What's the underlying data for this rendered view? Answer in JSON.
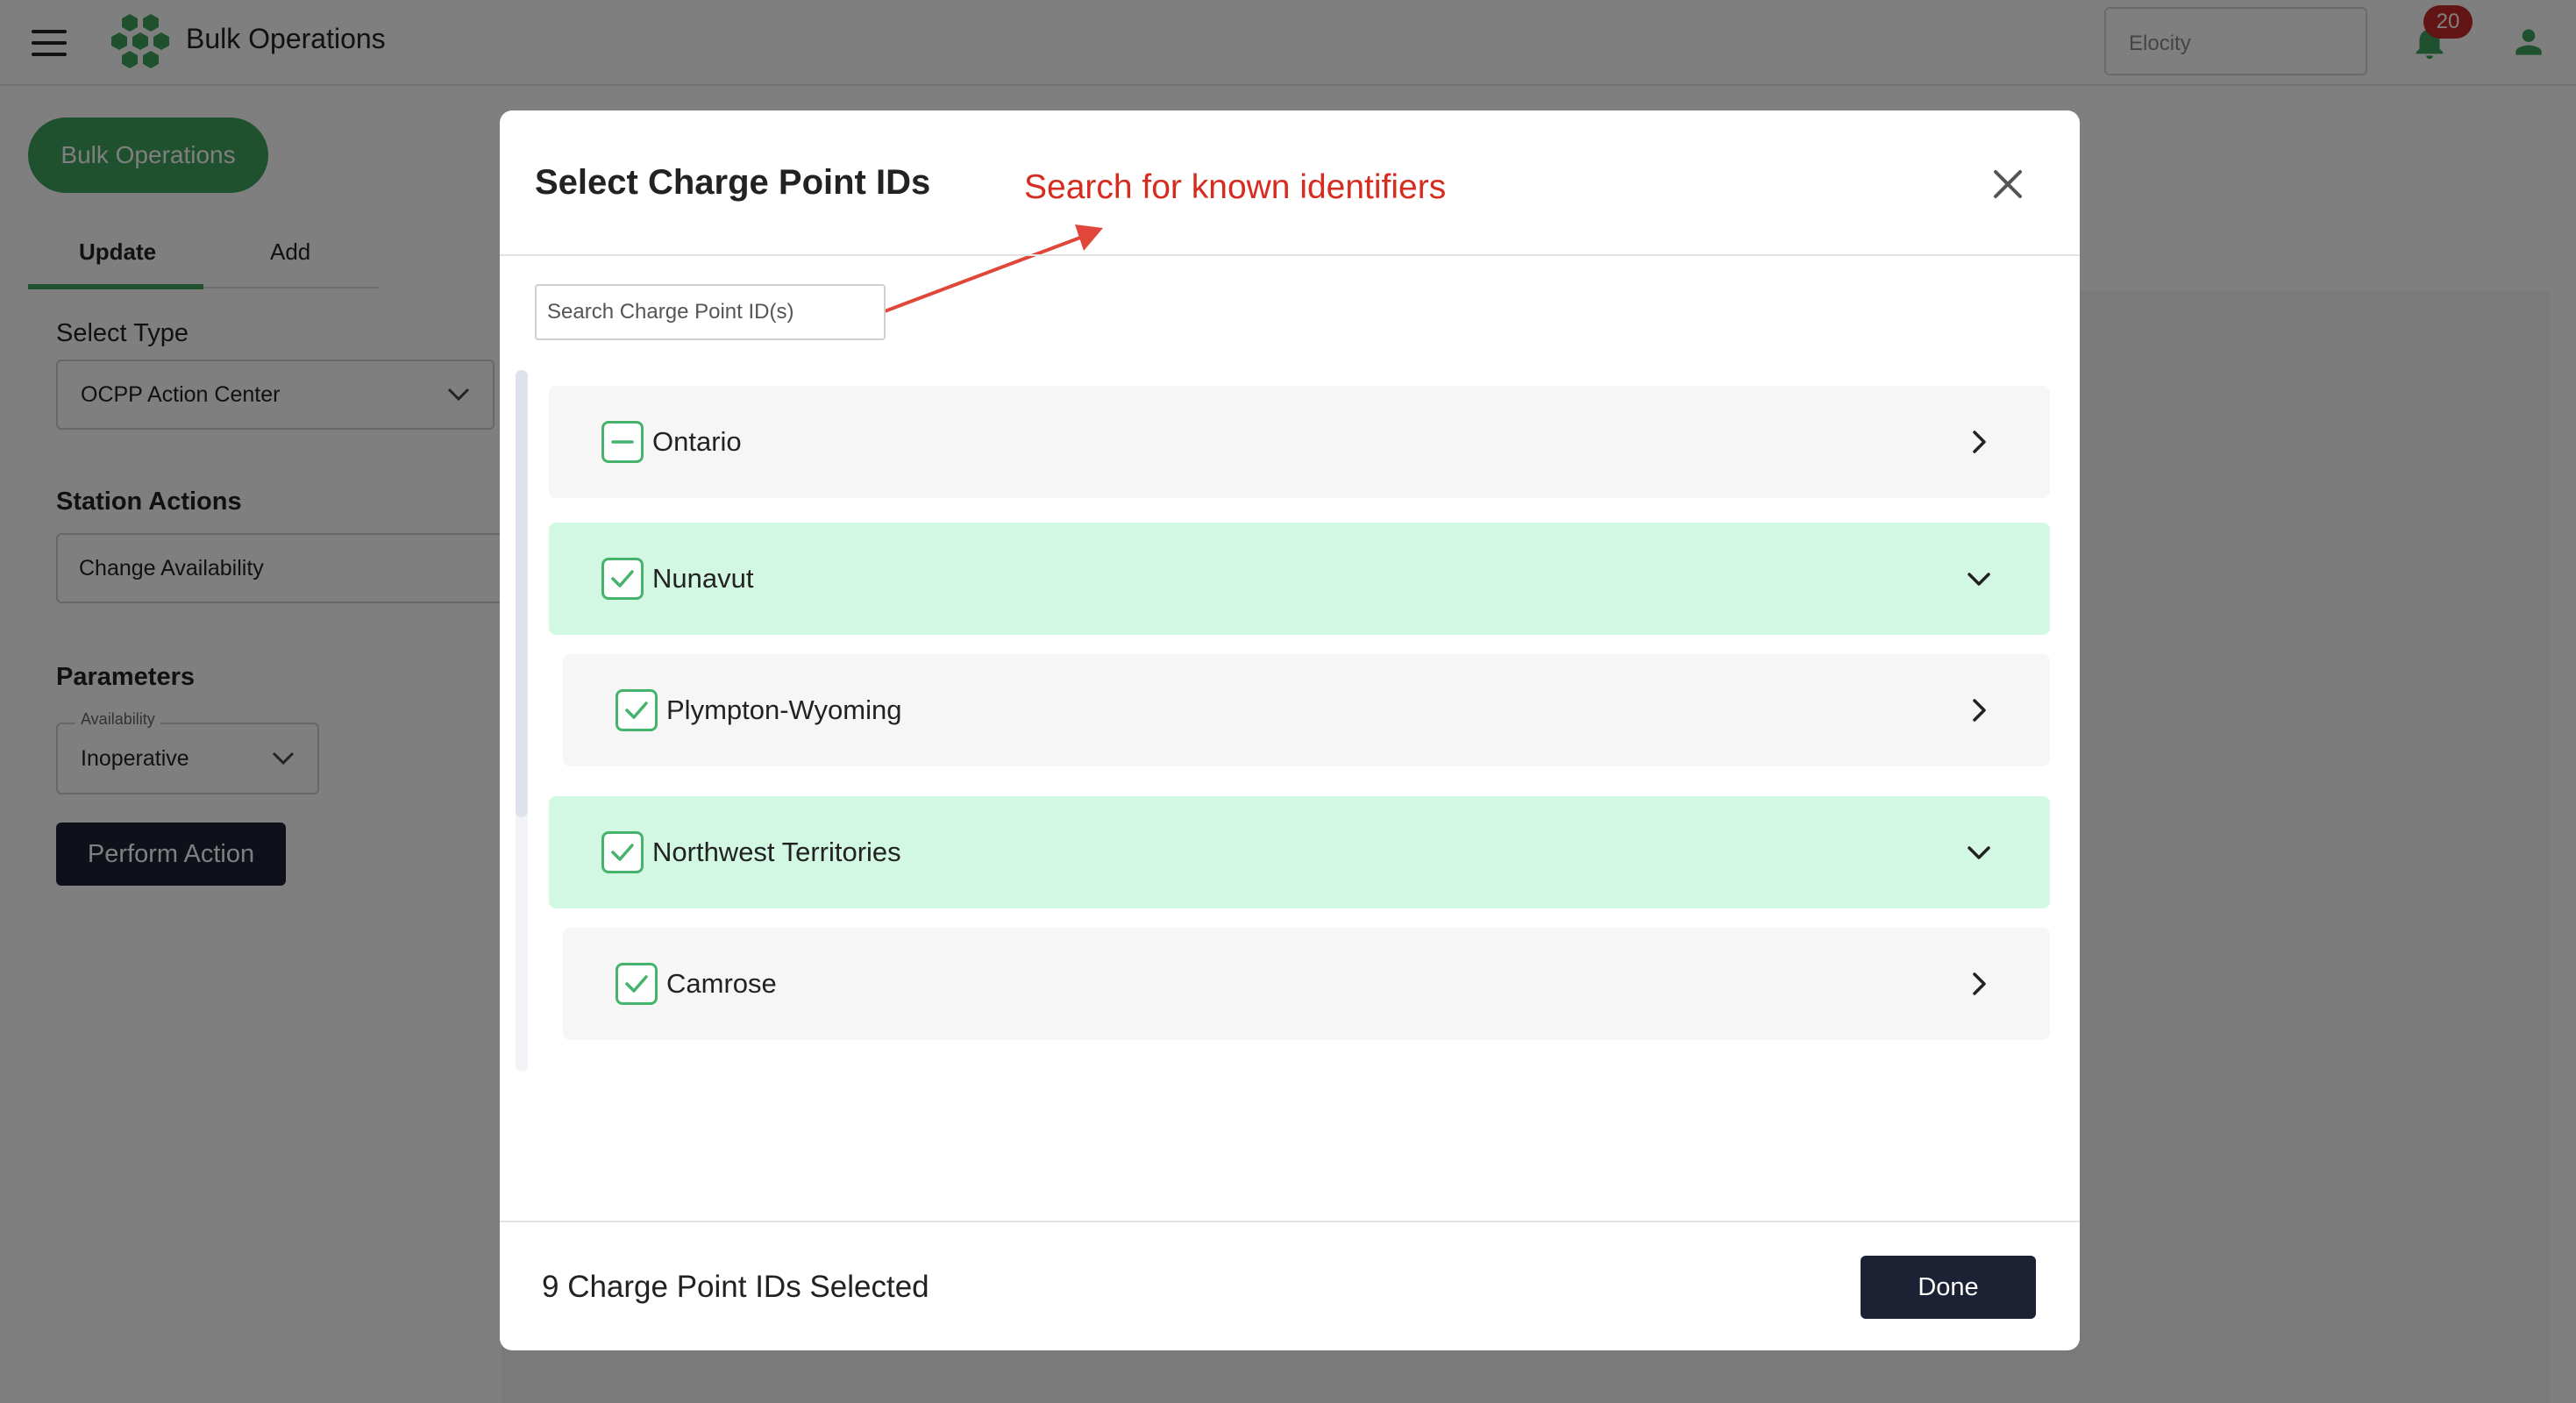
{
  "app": {
    "title": "Bulk Operations",
    "tenant_placeholder": "Elocity",
    "notification_count": "20",
    "brand_color": "#3ea35e"
  },
  "page": {
    "bulk_button": "Bulk Operations",
    "tabs": [
      "Update",
      "Add"
    ],
    "select_type_label": "Select Type",
    "select_type_value": "OCPP Action Center",
    "station_actions_label": "Station Actions",
    "station_action_value": "Change Availability",
    "parameters_label": "Parameters",
    "availability_label": "Availability",
    "availability_value": "Inoperative",
    "perform_button": "Perform Action"
  },
  "modal": {
    "title": "Select Charge Point IDs",
    "annotation": "Search for known identifiers",
    "search_placeholder": "Search Charge Point ID(s)",
    "rows": [
      {
        "label": "Ontario",
        "state": "partial",
        "expanded": false,
        "selected_bg": false
      },
      {
        "label": "Nunavut",
        "state": "checked",
        "expanded": true,
        "selected_bg": true
      },
      {
        "label": "Plympton-Wyoming",
        "state": "checked",
        "expanded": false,
        "selected_bg": false
      },
      {
        "label": "Northwest Territories",
        "state": "checked",
        "expanded": true,
        "selected_bg": true
      },
      {
        "label": "Camrose",
        "state": "checked",
        "expanded": false,
        "selected_bg": false
      }
    ],
    "selected_count": "9 Charge Point IDs Selected",
    "done_button": "Done",
    "annotation_color": "#d62c1f",
    "selected_row_color": "#d2f8e4"
  }
}
